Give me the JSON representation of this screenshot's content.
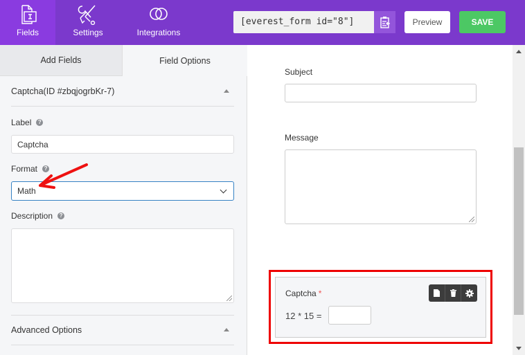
{
  "topbar": {
    "nav": [
      {
        "label": "Fields",
        "icon": "fields-icon",
        "active": true
      },
      {
        "label": "Settings",
        "icon": "settings-tools-icon",
        "active": false
      },
      {
        "label": "Integrations",
        "icon": "integrations-rings-icon",
        "active": false
      }
    ],
    "shortcode": "[everest_form id=\"8\"]",
    "copy_icon": "clipboard-copy-icon",
    "preview_label": "Preview",
    "save_label": "SAVE",
    "colors": {
      "bar": "#7b39cc",
      "active_nav": "#8a3be0",
      "save": "#4cc864"
    }
  },
  "left_panel": {
    "tabs": [
      {
        "label": "Add Fields",
        "active": false
      },
      {
        "label": "Field Options",
        "active": true
      }
    ],
    "section_title": "Captcha(ID #zbqjogrbKr-7)",
    "fields": {
      "label": {
        "label": "Label",
        "value": "Captcha"
      },
      "format": {
        "label": "Format",
        "value": "Math"
      },
      "description": {
        "label": "Description",
        "value": ""
      }
    },
    "advanced_title": "Advanced Options",
    "help_glyph": "?"
  },
  "preview": {
    "subject_label": "Subject",
    "message_label": "Message",
    "captcha": {
      "label": "Captcha",
      "required_mark": "*",
      "equation": "12 * 15 =",
      "answer": "",
      "toolbar": [
        "duplicate-icon",
        "trash-icon",
        "gear-icon"
      ]
    },
    "highlight_color": "#ee0000"
  }
}
